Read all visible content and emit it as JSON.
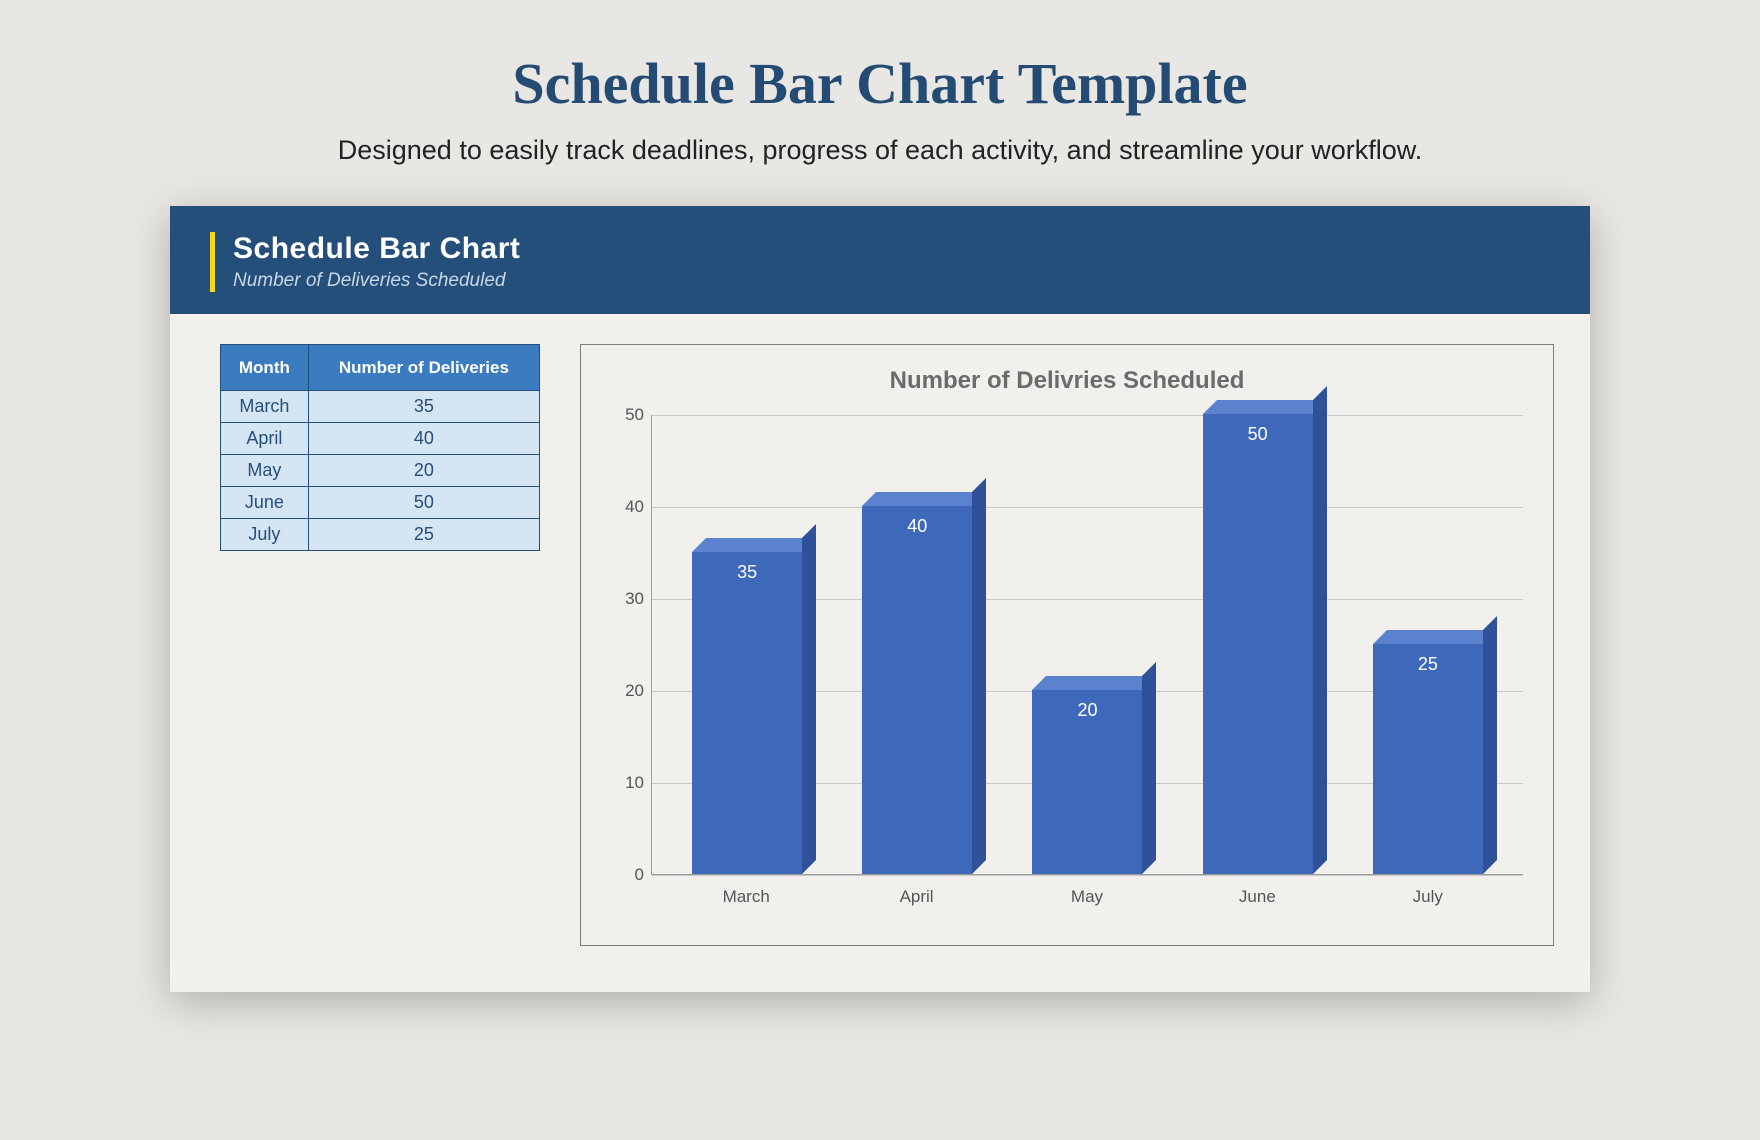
{
  "page": {
    "title": "Schedule Bar Chart Template",
    "subtitle": "Designed to easily track deadlines, progress of each activity, and streamline your workflow."
  },
  "card": {
    "title": "Schedule Bar Chart",
    "subtitle": "Number of Deliveries Scheduled"
  },
  "table": {
    "header_month": "Month",
    "header_value": "Number of Deliveries",
    "rows": [
      {
        "month": "March",
        "value": "35"
      },
      {
        "month": "April",
        "value": "40"
      },
      {
        "month": "May",
        "value": "20"
      },
      {
        "month": "June",
        "value": "50"
      },
      {
        "month": "July",
        "value": "25"
      }
    ]
  },
  "chart_data": {
    "type": "bar",
    "title": "Number of Delivries Scheduled",
    "xlabel": "",
    "ylabel": "",
    "categories": [
      "March",
      "April",
      "May",
      "June",
      "July"
    ],
    "values": [
      35,
      40,
      20,
      50,
      25
    ],
    "ylim": [
      0,
      50
    ],
    "yticks": [
      0,
      10,
      20,
      30,
      40,
      50
    ]
  }
}
